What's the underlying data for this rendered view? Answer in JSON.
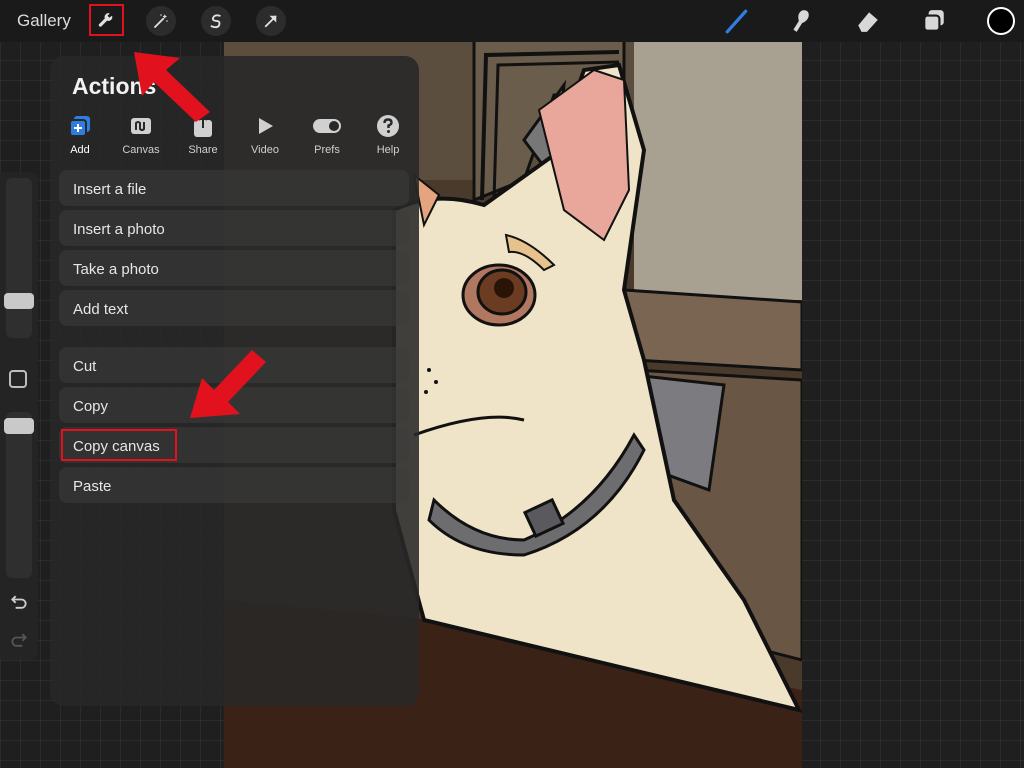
{
  "topbar": {
    "gallery_label": "Gallery",
    "tools": [
      "wrench-icon",
      "magic-wand-icon",
      "selection-icon",
      "transform-arrow-icon"
    ],
    "right_tools": [
      "brush-icon",
      "smudge-icon",
      "eraser-icon",
      "layers-icon"
    ],
    "color": "#000000",
    "brush_color": "#2f7de1"
  },
  "panel": {
    "title": "Actions",
    "tabs": [
      {
        "label": "Add",
        "icon": "add-icon",
        "active": true
      },
      {
        "label": "Canvas",
        "icon": "canvas-icon"
      },
      {
        "label": "Share",
        "icon": "share-icon"
      },
      {
        "label": "Video",
        "icon": "video-icon"
      },
      {
        "label": "Prefs",
        "icon": "prefs-toggle-icon"
      },
      {
        "label": "Help",
        "icon": "help-icon"
      }
    ],
    "group1": [
      "Insert a file",
      "Insert a photo",
      "Take a photo",
      "Add text"
    ],
    "group2": [
      "Cut",
      "Copy",
      "Copy canvas",
      "Paste"
    ]
  },
  "annotations": {
    "highlight_color": "#e1121e"
  }
}
